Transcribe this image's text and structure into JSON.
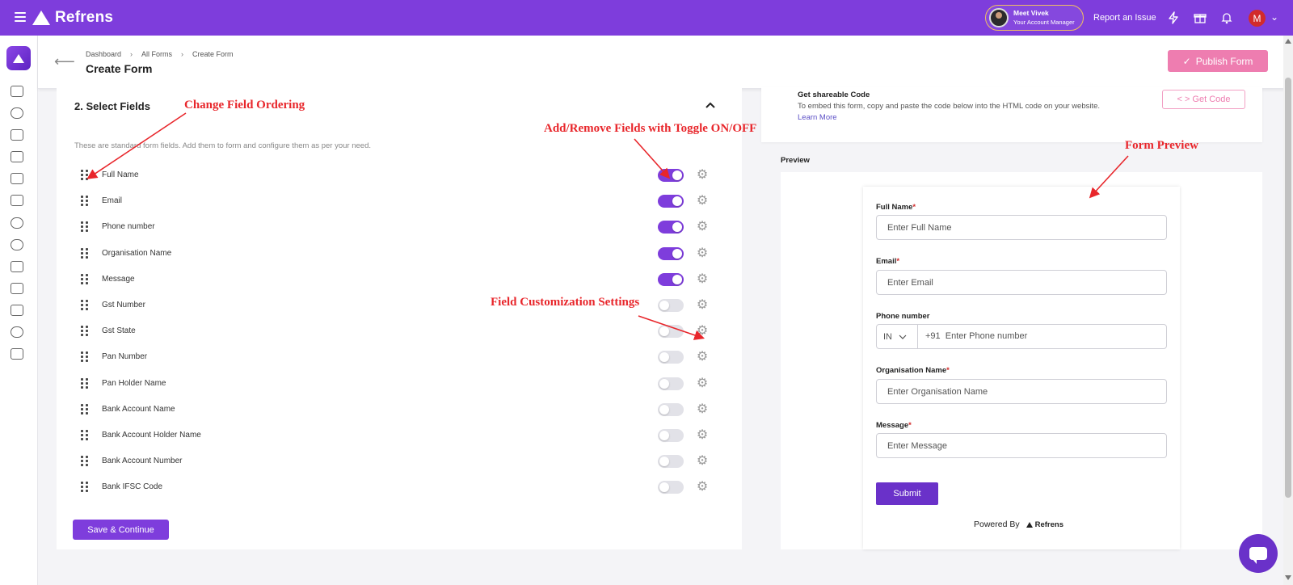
{
  "app": {
    "name": "Refrens"
  },
  "topbar": {
    "manager_name": "Meet Vivek",
    "manager_role": "Your Account Manager",
    "report_label": "Report an Issue",
    "user_initial": "M",
    "icons": [
      "lightning-icon",
      "gift-icon",
      "bell-icon"
    ]
  },
  "header": {
    "breadcrumb": [
      "Dashboard",
      "All Forms",
      "Create Form"
    ],
    "title": "Create Form",
    "publish_label": "Publish Form"
  },
  "fields_section": {
    "title": "2. Select Fields",
    "description": "These are standard form fields. Add them to form and configure them as per your need.",
    "fields": [
      {
        "label": "Full Name",
        "enabled": true
      },
      {
        "label": "Email",
        "enabled": true
      },
      {
        "label": "Phone number",
        "enabled": true
      },
      {
        "label": "Organisation Name",
        "enabled": true
      },
      {
        "label": "Message",
        "enabled": true
      },
      {
        "label": "Gst Number",
        "enabled": false
      },
      {
        "label": "Gst State",
        "enabled": false
      },
      {
        "label": "Pan Number",
        "enabled": false
      },
      {
        "label": "Pan Holder Name",
        "enabled": false
      },
      {
        "label": "Bank Account Name",
        "enabled": false
      },
      {
        "label": "Bank Account Holder Name",
        "enabled": false
      },
      {
        "label": "Bank Account Number",
        "enabled": false
      },
      {
        "label": "Bank IFSC Code",
        "enabled": false
      }
    ],
    "save_label": "Save & Continue"
  },
  "share": {
    "title": "Get shareable Code",
    "description": "To embed this form, copy and paste the code below into the HTML code on your website.",
    "learn_more": "Learn More",
    "get_code_label": "< > Get Code"
  },
  "preview": {
    "label": "Preview",
    "fields": [
      {
        "label": "Full Name",
        "placeholder": "Enter Full Name"
      },
      {
        "label": "Email",
        "placeholder": "Enter Email"
      },
      {
        "label": "Phone number",
        "country": "IN",
        "dial_code": "+91",
        "placeholder": "Enter Phone number"
      },
      {
        "label": "Organisation Name",
        "placeholder": "Enter Organisation Name"
      },
      {
        "label": "Message",
        "placeholder": "Enter Message"
      }
    ],
    "required_mark": "*",
    "submit_label": "Submit",
    "powered_by": "Powered By",
    "powered_brand": "Refrens"
  },
  "annotations": {
    "ordering": "Change Field Ordering",
    "toggle": "Add/Remove Fields with Toggle ON/OFF",
    "settings": "Field Customization Settings",
    "preview": "Form Preview"
  },
  "colors": {
    "brand": "#7e3ddc",
    "publish": "#ee7db0",
    "annotation": "#e8262b",
    "submit": "#6a31c9"
  }
}
